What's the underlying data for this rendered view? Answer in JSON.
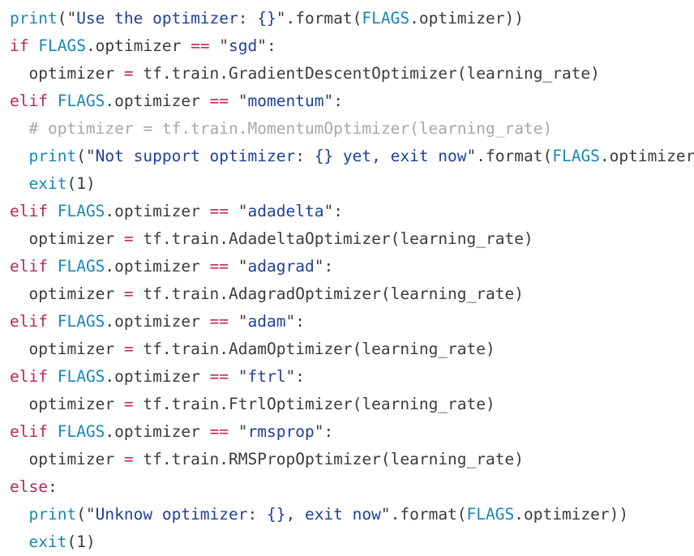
{
  "editor": {
    "language": "python",
    "background_color": "#ffffff",
    "line_count": 19,
    "theme_colors": {
      "keyword": "#c0265c",
      "builtin": "#1787b4",
      "name": "#1787b4",
      "string": "#20409a",
      "operator": "#c0265c",
      "plain": "#3b3b3b",
      "comment": "#a8a8a8",
      "number": "#3b3b3b"
    }
  },
  "code": {
    "lines": [
      {
        "index": 1,
        "indent": "",
        "text": "print(\"Use the optimizer: {}\".format(FLAGS.optimizer))",
        "tokens": [
          {
            "t": "print",
            "c": "t-builtin"
          },
          {
            "t": "(\"",
            "c": "t-quote"
          },
          {
            "t": "Use the optimizer: {}",
            "c": "t-str"
          },
          {
            "t": "\".format(",
            "c": "t-quote"
          },
          {
            "t": "FLAGS",
            "c": "t-name"
          },
          {
            "t": ".optimizer))",
            "c": "t-plain"
          }
        ]
      },
      {
        "index": 2,
        "indent": "",
        "text": "if FLAGS.optimizer == \"sgd\":",
        "tokens": [
          {
            "t": "if",
            "c": "t-kw"
          },
          {
            "t": " ",
            "c": "t-plain"
          },
          {
            "t": "FLAGS",
            "c": "t-name"
          },
          {
            "t": ".optimizer ",
            "c": "t-plain"
          },
          {
            "t": "==",
            "c": "t-op"
          },
          {
            "t": " \"",
            "c": "t-quote"
          },
          {
            "t": "sgd",
            "c": "t-str"
          },
          {
            "t": "\":",
            "c": "t-quote"
          }
        ]
      },
      {
        "index": 3,
        "indent": "  ",
        "text": "  optimizer = tf.train.GradientDescentOptimizer(learning_rate)",
        "tokens": [
          {
            "t": "  optimizer ",
            "c": "t-plain"
          },
          {
            "t": "=",
            "c": "t-op"
          },
          {
            "t": " tf.train.GradientDescentOptimizer(learning_rate)",
            "c": "t-plain"
          }
        ]
      },
      {
        "index": 4,
        "indent": "",
        "text": "elif FLAGS.optimizer == \"momentum\":",
        "tokens": [
          {
            "t": "elif",
            "c": "t-kw"
          },
          {
            "t": " ",
            "c": "t-plain"
          },
          {
            "t": "FLAGS",
            "c": "t-name"
          },
          {
            "t": ".optimizer ",
            "c": "t-plain"
          },
          {
            "t": "==",
            "c": "t-op"
          },
          {
            "t": " \"",
            "c": "t-quote"
          },
          {
            "t": "momentum",
            "c": "t-str"
          },
          {
            "t": "\":",
            "c": "t-quote"
          }
        ]
      },
      {
        "index": 5,
        "indent": "  ",
        "text": "  # optimizer = tf.train.MomentumOptimizer(learning_rate)",
        "tokens": [
          {
            "t": "  # optimizer = tf.train.MomentumOptimizer(learning_rate)",
            "c": "t-comment"
          }
        ]
      },
      {
        "index": 6,
        "indent": "  ",
        "text": "  print(\"Not support optimizer: {} yet, exit now\".format(FLAGS.optimizer))",
        "tokens": [
          {
            "t": "  ",
            "c": "t-plain"
          },
          {
            "t": "print",
            "c": "t-builtin"
          },
          {
            "t": "(\"",
            "c": "t-quote"
          },
          {
            "t": "Not support optimizer: {} yet, exit now",
            "c": "t-str"
          },
          {
            "t": "\".format(",
            "c": "t-quote"
          },
          {
            "t": "FLAGS",
            "c": "t-name"
          },
          {
            "t": ".optimizer))",
            "c": "t-plain"
          }
        ]
      },
      {
        "index": 7,
        "indent": "  ",
        "text": "  exit(1)",
        "tokens": [
          {
            "t": "  ",
            "c": "t-plain"
          },
          {
            "t": "exit",
            "c": "t-builtin"
          },
          {
            "t": "(",
            "c": "t-quote"
          },
          {
            "t": "1",
            "c": "t-num"
          },
          {
            "t": ")",
            "c": "t-quote"
          }
        ]
      },
      {
        "index": 8,
        "indent": "",
        "text": "elif FLAGS.optimizer == \"adadelta\":",
        "tokens": [
          {
            "t": "elif",
            "c": "t-kw"
          },
          {
            "t": " ",
            "c": "t-plain"
          },
          {
            "t": "FLAGS",
            "c": "t-name"
          },
          {
            "t": ".optimizer ",
            "c": "t-plain"
          },
          {
            "t": "==",
            "c": "t-op"
          },
          {
            "t": " \"",
            "c": "t-quote"
          },
          {
            "t": "adadelta",
            "c": "t-str"
          },
          {
            "t": "\":",
            "c": "t-quote"
          }
        ]
      },
      {
        "index": 9,
        "indent": "  ",
        "text": "  optimizer = tf.train.AdadeltaOptimizer(learning_rate)",
        "tokens": [
          {
            "t": "  optimizer ",
            "c": "t-plain"
          },
          {
            "t": "=",
            "c": "t-op"
          },
          {
            "t": " tf.train.AdadeltaOptimizer(learning_rate)",
            "c": "t-plain"
          }
        ]
      },
      {
        "index": 10,
        "indent": "",
        "text": "elif FLAGS.optimizer == \"adagrad\":",
        "tokens": [
          {
            "t": "elif",
            "c": "t-kw"
          },
          {
            "t": " ",
            "c": "t-plain"
          },
          {
            "t": "FLAGS",
            "c": "t-name"
          },
          {
            "t": ".optimizer ",
            "c": "t-plain"
          },
          {
            "t": "==",
            "c": "t-op"
          },
          {
            "t": " \"",
            "c": "t-quote"
          },
          {
            "t": "adagrad",
            "c": "t-str"
          },
          {
            "t": "\":",
            "c": "t-quote"
          }
        ]
      },
      {
        "index": 11,
        "indent": "  ",
        "text": "  optimizer = tf.train.AdagradOptimizer(learning_rate)",
        "tokens": [
          {
            "t": "  optimizer ",
            "c": "t-plain"
          },
          {
            "t": "=",
            "c": "t-op"
          },
          {
            "t": " tf.train.AdagradOptimizer(learning_rate)",
            "c": "t-plain"
          }
        ]
      },
      {
        "index": 12,
        "indent": "",
        "text": "elif FLAGS.optimizer == \"adam\":",
        "tokens": [
          {
            "t": "elif",
            "c": "t-kw"
          },
          {
            "t": " ",
            "c": "t-plain"
          },
          {
            "t": "FLAGS",
            "c": "t-name"
          },
          {
            "t": ".optimizer ",
            "c": "t-plain"
          },
          {
            "t": "==",
            "c": "t-op"
          },
          {
            "t": " \"",
            "c": "t-quote"
          },
          {
            "t": "adam",
            "c": "t-str"
          },
          {
            "t": "\":",
            "c": "t-quote"
          }
        ]
      },
      {
        "index": 13,
        "indent": "  ",
        "text": "  optimizer = tf.train.AdamOptimizer(learning_rate)",
        "tokens": [
          {
            "t": "  optimizer ",
            "c": "t-plain"
          },
          {
            "t": "=",
            "c": "t-op"
          },
          {
            "t": " tf.train.AdamOptimizer(learning_rate)",
            "c": "t-plain"
          }
        ]
      },
      {
        "index": 14,
        "indent": "",
        "text": "elif FLAGS.optimizer == \"ftrl\":",
        "tokens": [
          {
            "t": "elif",
            "c": "t-kw"
          },
          {
            "t": " ",
            "c": "t-plain"
          },
          {
            "t": "FLAGS",
            "c": "t-name"
          },
          {
            "t": ".optimizer ",
            "c": "t-plain"
          },
          {
            "t": "==",
            "c": "t-op"
          },
          {
            "t": " \"",
            "c": "t-quote"
          },
          {
            "t": "ftrl",
            "c": "t-str"
          },
          {
            "t": "\":",
            "c": "t-quote"
          }
        ]
      },
      {
        "index": 15,
        "indent": "  ",
        "text": "  optimizer = tf.train.FtrlOptimizer(learning_rate)",
        "tokens": [
          {
            "t": "  optimizer ",
            "c": "t-plain"
          },
          {
            "t": "=",
            "c": "t-op"
          },
          {
            "t": " tf.train.FtrlOptimizer(learning_rate)",
            "c": "t-plain"
          }
        ]
      },
      {
        "index": 16,
        "indent": "",
        "text": "elif FLAGS.optimizer == \"rmsprop\":",
        "tokens": [
          {
            "t": "elif",
            "c": "t-kw"
          },
          {
            "t": " ",
            "c": "t-plain"
          },
          {
            "t": "FLAGS",
            "c": "t-name"
          },
          {
            "t": ".optimizer ",
            "c": "t-plain"
          },
          {
            "t": "==",
            "c": "t-op"
          },
          {
            "t": " \"",
            "c": "t-quote"
          },
          {
            "t": "rmsprop",
            "c": "t-str"
          },
          {
            "t": "\":",
            "c": "t-quote"
          }
        ]
      },
      {
        "index": 17,
        "indent": "  ",
        "text": "  optimizer = tf.train.RMSPropOptimizer(learning_rate)",
        "tokens": [
          {
            "t": "  optimizer ",
            "c": "t-plain"
          },
          {
            "t": "=",
            "c": "t-op"
          },
          {
            "t": " tf.train.RMSPropOptimizer(learning_rate)",
            "c": "t-plain"
          }
        ]
      },
      {
        "index": 18,
        "indent": "",
        "text": "else:",
        "tokens": [
          {
            "t": "else",
            "c": "t-kw"
          },
          {
            "t": ":",
            "c": "t-quote"
          }
        ]
      },
      {
        "index": 19,
        "indent": "  ",
        "text": "  print(\"Unknow optimizer: {}, exit now\".format(FLAGS.optimizer))",
        "tokens": [
          {
            "t": "  ",
            "c": "t-plain"
          },
          {
            "t": "print",
            "c": "t-builtin"
          },
          {
            "t": "(\"",
            "c": "t-quote"
          },
          {
            "t": "Unknow optimizer: {}, exit now",
            "c": "t-str"
          },
          {
            "t": "\".format(",
            "c": "t-quote"
          },
          {
            "t": "FLAGS",
            "c": "t-name"
          },
          {
            "t": ".optimizer))",
            "c": "t-plain"
          }
        ]
      },
      {
        "index": 20,
        "indent": "  ",
        "text": "  exit(1)",
        "tokens": [
          {
            "t": "  ",
            "c": "t-plain"
          },
          {
            "t": "exit",
            "c": "t-builtin"
          },
          {
            "t": "(",
            "c": "t-quote"
          },
          {
            "t": "1",
            "c": "t-num"
          },
          {
            "t": ")",
            "c": "t-quote"
          }
        ]
      }
    ]
  }
}
